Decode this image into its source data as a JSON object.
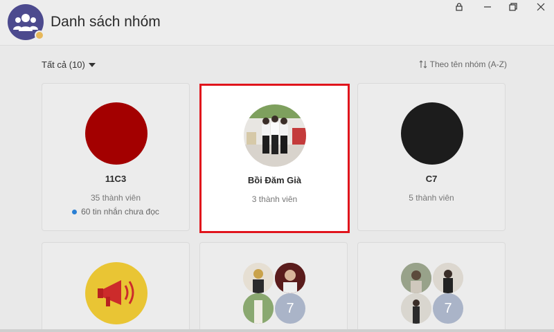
{
  "header": {
    "title": "Danh sách nhóm"
  },
  "window_controls": {
    "lock": "lock-icon",
    "minimize": "minimize-icon",
    "restore": "restore-icon",
    "close": "close-icon"
  },
  "toolbar": {
    "filter_label": "Tất cả (10)",
    "sort_label": "Theo tên nhóm (A-Z)"
  },
  "colors": {
    "selection_border": "#e0141c",
    "app_icon_bg": "#4c4a8e",
    "unread_dot": "#2a7fd4",
    "group_11c3": "#a30000",
    "group_c7": "#1c1c1c",
    "megaphone_bg": "#e9c534"
  },
  "groups": [
    {
      "name": "11C3",
      "members": "35 thành viên",
      "unread": "60 tin nhắn chưa đọc"
    },
    {
      "name": "Bồi Đăm Già",
      "members": "3 thành viên",
      "selected": true
    },
    {
      "name": "C7",
      "members": "5 thành viên"
    },
    {
      "avatar": "megaphone-icon"
    },
    {
      "avatar_count": "7"
    },
    {
      "avatar_count": "7"
    }
  ]
}
